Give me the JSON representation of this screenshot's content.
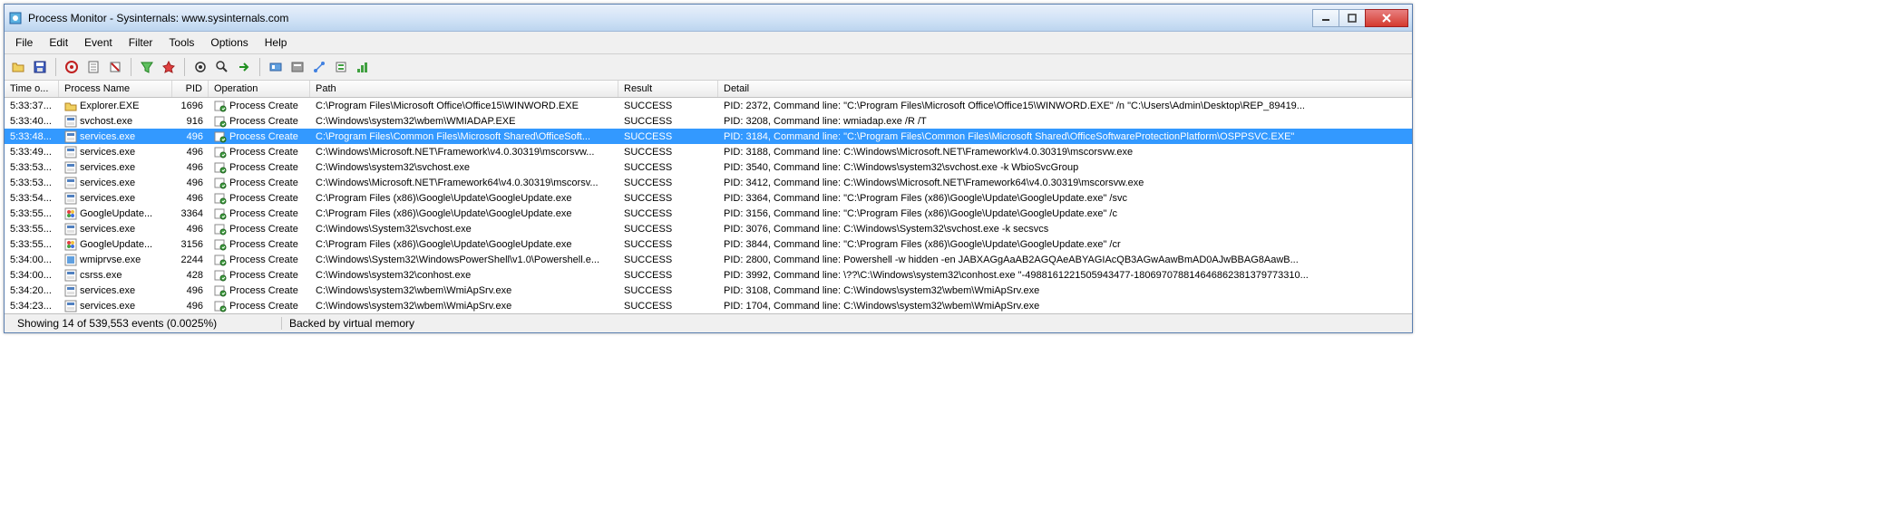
{
  "window": {
    "title": "Process Monitor - Sysinternals: www.sysinternals.com"
  },
  "menu": {
    "items": [
      "File",
      "Edit",
      "Event",
      "Filter",
      "Tools",
      "Options",
      "Help"
    ]
  },
  "toolbar": {
    "buttons": [
      "open",
      "save",
      "sep",
      "capture",
      "autoscroll",
      "clear",
      "sep",
      "filter",
      "highlight",
      "sep",
      "include-process",
      "find",
      "jump",
      "sep",
      "show-registry",
      "show-filesystem",
      "show-network",
      "show-process",
      "show-profiling"
    ]
  },
  "columns": [
    {
      "key": "time",
      "label": "Time o..."
    },
    {
      "key": "process",
      "label": "Process Name"
    },
    {
      "key": "pid",
      "label": "PID"
    },
    {
      "key": "operation",
      "label": "Operation"
    },
    {
      "key": "path",
      "label": "Path"
    },
    {
      "key": "result",
      "label": "Result"
    },
    {
      "key": "detail",
      "label": "Detail"
    }
  ],
  "rows": [
    {
      "time": "5:33:37...",
      "process": "Explorer.EXE",
      "pid": "1696",
      "operation": "Process Create",
      "path": "C:\\Program Files\\Microsoft Office\\Office15\\WINWORD.EXE",
      "result": "SUCCESS",
      "detail": "PID: 2372, Command line: \"C:\\Program Files\\Microsoft Office\\Office15\\WINWORD.EXE\" /n \"C:\\Users\\Admin\\Desktop\\REP_89419...",
      "icon": "explorer",
      "selected": false
    },
    {
      "time": "5:33:40...",
      "process": "svchost.exe",
      "pid": "916",
      "operation": "Process Create",
      "path": "C:\\Windows\\system32\\wbem\\WMIADAP.EXE",
      "result": "SUCCESS",
      "detail": "PID: 3208, Command line: wmiadap.exe /R /T",
      "icon": "svc",
      "selected": false
    },
    {
      "time": "5:33:48...",
      "process": "services.exe",
      "pid": "496",
      "operation": "Process Create",
      "path": "C:\\Program Files\\Common Files\\Microsoft Shared\\OfficeSoft...",
      "result": "SUCCESS",
      "detail": "PID: 3184, Command line: \"C:\\Program Files\\Common Files\\Microsoft Shared\\OfficeSoftwareProtectionPlatform\\OSPPSVC.EXE\"",
      "icon": "svc",
      "selected": true
    },
    {
      "time": "5:33:49...",
      "process": "services.exe",
      "pid": "496",
      "operation": "Process Create",
      "path": "C:\\Windows\\Microsoft.NET\\Framework\\v4.0.30319\\mscorsvw...",
      "result": "SUCCESS",
      "detail": "PID: 3188, Command line: C:\\Windows\\Microsoft.NET\\Framework\\v4.0.30319\\mscorsvw.exe",
      "icon": "svc",
      "selected": false
    },
    {
      "time": "5:33:53...",
      "process": "services.exe",
      "pid": "496",
      "operation": "Process Create",
      "path": "C:\\Windows\\system32\\svchost.exe",
      "result": "SUCCESS",
      "detail": "PID: 3540, Command line: C:\\Windows\\system32\\svchost.exe -k WbioSvcGroup",
      "icon": "svc",
      "selected": false
    },
    {
      "time": "5:33:53...",
      "process": "services.exe",
      "pid": "496",
      "operation": "Process Create",
      "path": "C:\\Windows\\Microsoft.NET\\Framework64\\v4.0.30319\\mscorsv...",
      "result": "SUCCESS",
      "detail": "PID: 3412, Command line: C:\\Windows\\Microsoft.NET\\Framework64\\v4.0.30319\\mscorsvw.exe",
      "icon": "svc",
      "selected": false
    },
    {
      "time": "5:33:54...",
      "process": "services.exe",
      "pid": "496",
      "operation": "Process Create",
      "path": "C:\\Program Files (x86)\\Google\\Update\\GoogleUpdate.exe",
      "result": "SUCCESS",
      "detail": "PID: 3364, Command line: \"C:\\Program Files (x86)\\Google\\Update\\GoogleUpdate.exe\" /svc",
      "icon": "svc",
      "selected": false
    },
    {
      "time": "5:33:55...",
      "process": "GoogleUpdate...",
      "pid": "3364",
      "operation": "Process Create",
      "path": "C:\\Program Files (x86)\\Google\\Update\\GoogleUpdate.exe",
      "result": "SUCCESS",
      "detail": "PID: 3156, Command line: \"C:\\Program Files (x86)\\Google\\Update\\GoogleUpdate.exe\" /c",
      "icon": "gup",
      "selected": false
    },
    {
      "time": "5:33:55...",
      "process": "services.exe",
      "pid": "496",
      "operation": "Process Create",
      "path": "C:\\Windows\\System32\\svchost.exe",
      "result": "SUCCESS",
      "detail": "PID: 3076, Command line: C:\\Windows\\System32\\svchost.exe -k secsvcs",
      "icon": "svc",
      "selected": false
    },
    {
      "time": "5:33:55...",
      "process": "GoogleUpdate...",
      "pid": "3156",
      "operation": "Process Create",
      "path": "C:\\Program Files (x86)\\Google\\Update\\GoogleUpdate.exe",
      "result": "SUCCESS",
      "detail": "PID: 3844, Command line: \"C:\\Program Files (x86)\\Google\\Update\\GoogleUpdate.exe\" /cr",
      "icon": "gup",
      "selected": false
    },
    {
      "time": "5:34:00...",
      "process": "wmiprvse.exe",
      "pid": "2244",
      "operation": "Process Create",
      "path": "C:\\Windows\\System32\\WindowsPowerShell\\v1.0\\Powershell.e...",
      "result": "SUCCESS",
      "detail": "PID: 2800, Command line: Powershell -w hidden -en JABXAGgAaAB2AGQAeABYAGIAcQB3AGwAawBmAD0AJwBBAG8AawB...",
      "icon": "wmi",
      "selected": false
    },
    {
      "time": "5:34:00...",
      "process": "csrss.exe",
      "pid": "428",
      "operation": "Process Create",
      "path": "C:\\Windows\\system32\\conhost.exe",
      "result": "SUCCESS",
      "detail": "PID: 3992, Command line: \\??\\C:\\Windows\\system32\\conhost.exe \"-4988161221505943477-180697078814646862381379773310...",
      "icon": "svc",
      "selected": false
    },
    {
      "time": "5:34:20...",
      "process": "services.exe",
      "pid": "496",
      "operation": "Process Create",
      "path": "C:\\Windows\\system32\\wbem\\WmiApSrv.exe",
      "result": "SUCCESS",
      "detail": "PID: 3108, Command line: C:\\Windows\\system32\\wbem\\WmiApSrv.exe",
      "icon": "svc",
      "selected": false
    },
    {
      "time": "5:34:23...",
      "process": "services.exe",
      "pid": "496",
      "operation": "Process Create",
      "path": "C:\\Windows\\system32\\wbem\\WmiApSrv.exe",
      "result": "SUCCESS",
      "detail": "PID: 1704, Command line: C:\\Windows\\system32\\wbem\\WmiApSrv.exe",
      "icon": "svc",
      "selected": false
    }
  ],
  "status": {
    "left": "Showing 14 of 539,553 events (0.0025%)",
    "right": "Backed by virtual memory"
  }
}
